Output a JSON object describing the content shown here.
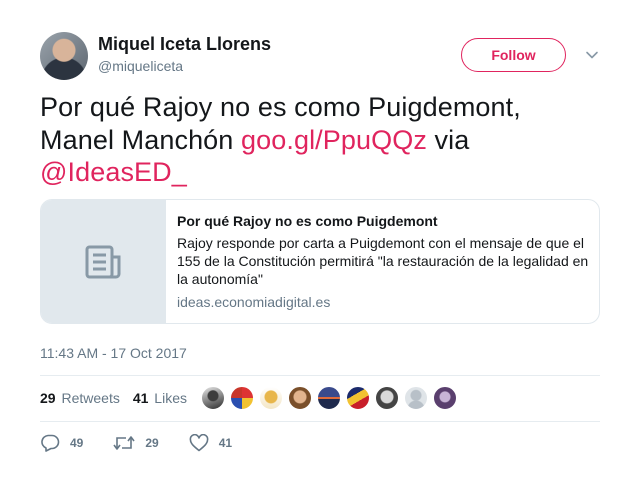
{
  "author": {
    "name": "Miquel Iceta Llorens",
    "handle": "@miqueliceta"
  },
  "follow_label": "Follow",
  "tweet": {
    "text_1": "Por qué Rajoy no es como Puigdemont, Manel Manchón ",
    "link": "goo.gl/PpuQQz",
    "text_2": " via ",
    "mention": "@IdeasED_"
  },
  "card": {
    "title": "Por qué Rajoy no es como Puigdemont",
    "description": "Rajoy responde por carta a Puigdemont con el mensaje de que el 155 de la Constitución permitirá \"la restauración de la legalidad en la autonomía\"",
    "domain": "ideas.economiadigital.es",
    "thumb_icon": "document-icon"
  },
  "timestamp": "11:43 AM - 17 Oct 2017",
  "stats": {
    "retweets_count": "29",
    "retweets_label": "Retweets",
    "likes_count": "41",
    "likes_label": "Likes"
  },
  "actions": {
    "reply_count": "49",
    "retweet_count": "29",
    "like_count": "41"
  },
  "colors": {
    "accent": "#e0245e",
    "secondary_text": "#657786",
    "border": "#e1e8ed"
  }
}
